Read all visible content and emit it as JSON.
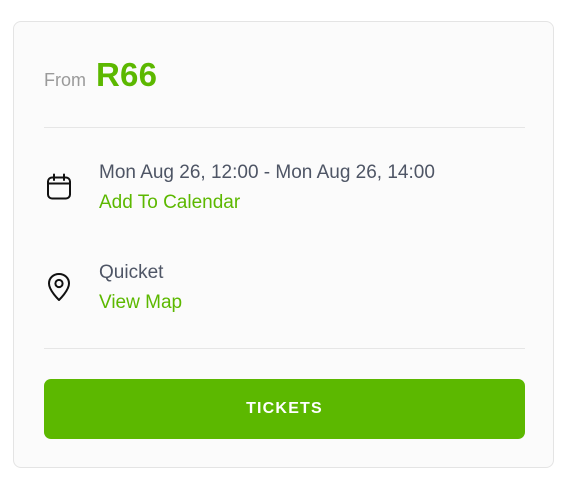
{
  "price": {
    "from_label": "From",
    "amount": "R66"
  },
  "event_date": {
    "icon": "calendar-icon",
    "datetime": "Mon Aug 26, 12:00 - Mon Aug 26, 14:00",
    "link_label": "Add To Calendar"
  },
  "venue": {
    "icon": "location-pin-icon",
    "name": "Quicket",
    "link_label": "View Map"
  },
  "actions": {
    "tickets_label": "TICKETS"
  },
  "colors": {
    "accent": "#5cb800",
    "text_primary": "#4e5565",
    "text_muted": "#9a9a9a",
    "card_background": "#fbfbfb",
    "divider": "#e6e6e6"
  }
}
